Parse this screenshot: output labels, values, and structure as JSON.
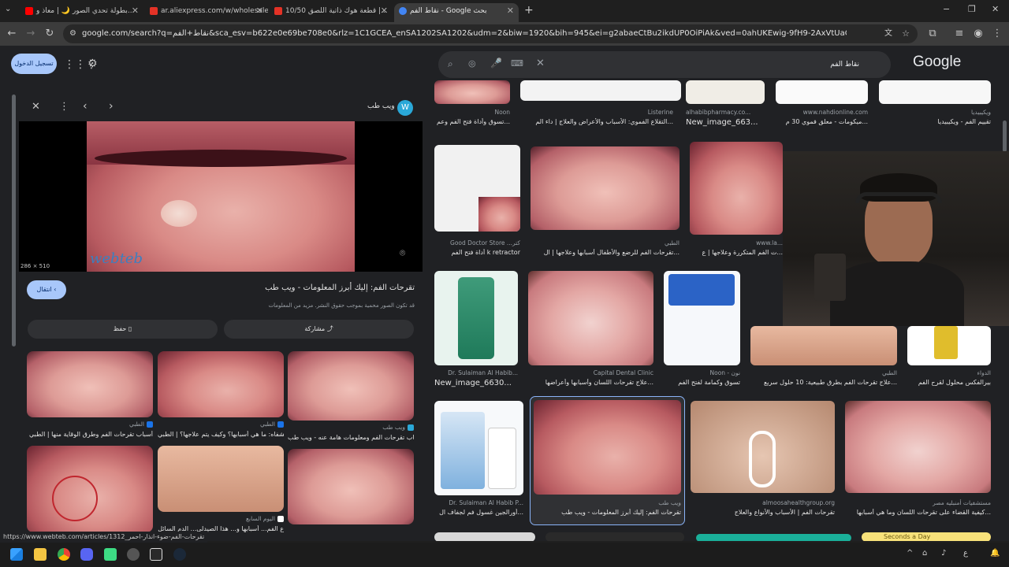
{
  "tabs": [
    {
      "label": "بطولة تحدي الصور 🌙 | معاذ و...",
      "favicon_color": "#ff0000"
    },
    {
      "label": "ar.aliexpress.com/w/wholesale-",
      "favicon_color": "#e43226"
    },
    {
      "label": "10/50 قطعة هوك ذاتية اللصق |...",
      "favicon_color": "#e43226"
    },
    {
      "label": "نقاط الفم - Google بحث",
      "favicon_color": "#4285f4",
      "active": true
    }
  ],
  "toolbar": {
    "url": "google.com/search?q=نقاط+الفم&sca_esv=b622e0e69be708e0&rlz=1C1GCEA_enSA1202SA1202&udm=2&biw=1920&bih=945&ei=g2abaeCtBu2ikdUP0OiPiAk&ved=0ahUKEwig-9fH9-2AxVtUaQEHVD0A5EQ4dUDCBQ&uact=5&oq=نقاط+ال..."
  },
  "header": {
    "signin_label": "تسجيل الدخول",
    "search_query": "نقاط الفم",
    "logo": "Google"
  },
  "panel": {
    "site_name": "ويب طب",
    "image_size": "286 × 510",
    "watermark": "webteb",
    "title": "تقرحات الفم: إليك أبرز المعلومات - ويب طب",
    "visit_label": "انتقال",
    "copyright_note": "قد تكون الصور محمية بموجب حقوق النشر. مزيد من المعلومات",
    "share_label": "مشاركة",
    "save_label": "حفظ",
    "related": [
      {
        "caption": "أسباب تقرحات الفم وطرق الوقاية منها | الطبي",
        "source": "الطبي",
        "badge": "#1a73e8"
      },
      {
        "caption": "تقرحات الشفاه: ما هي أسبابها؟ وكيف يتم علاجها؟ | الطبي",
        "source": "الطبي",
        "badge": "#1a73e8"
      },
      {
        "caption": "أسباب تقرحات الفم ومعلومات هامة عنه - ويب طب",
        "source": "ويب طب",
        "badge": "#2aa8d8"
      },
      {
        "caption": "",
        "source": "",
        "badge": ""
      },
      {
        "caption": "ع الفم... أسبابها و... هذا الصيدلي... الدم السائل",
        "source": "اليوم السابع",
        "badge": "#ffffff"
      },
      {
        "caption": "",
        "source": "",
        "badge": ""
      }
    ]
  },
  "results": {
    "row0": [
      {
        "source": "ويكيبيديا",
        "caption": "تقييم الفم - ويكيبيديا"
      },
      {
        "source": "www.nahdionline.com",
        "caption": "ميكومات - معلق فموي 30 م..."
      },
      {
        "source": "alhabibpharmacy.co...",
        "caption": "New_image_663..."
      },
      {
        "source": "Listerine",
        "caption": "التقلاع الفموي: الأسباب والأعراض والعلاج | داء الم..."
      },
      {
        "source": "Noon",
        "caption": "تسوق وأداة فتح الفم وعم..."
      }
    ],
    "row1": [
      {
        "source": "Good Doctor Store ...كتر",
        "caption": "أداة فتح الفم k retractor"
      },
      {
        "source": "الطبي",
        "caption": "تقرحات الفم للرضع والأطفال أسبابها وعلاجها | ال..."
      },
      {
        "source": "www.la...",
        "caption": "ت الفم المتكررة وعلاجها | ع..."
      }
    ],
    "row2": [
      {
        "source": "Dr. Sulaiman Al Habib...",
        "caption": "New_image_6630..."
      },
      {
        "source": "Capital Dental Clinic",
        "caption": "علاج تقرحات اللسان وأسبابها وأعراضها..."
      },
      {
        "source": "Noon - نون",
        "caption": "تسوق وكمامة لفتح الفم"
      },
      {
        "source": "الطبي",
        "caption": "علاج تقرحات الفم بطرق طبيعية: 10 حلول سريع..."
      },
      {
        "source": "الدواء",
        "caption": "بيرالفكس محلول لقرح الفم"
      }
    ],
    "row3": [
      {
        "source": "Dr. Sulaiman Al Habib P...",
        "caption": "أورالجين غسول فم لجفاف ال..."
      },
      {
        "source": "ويب طب",
        "caption": "تقرحات الفم: إليك أبرز المعلومات - ويب طب"
      },
      {
        "source": "almoosahealthgroup.org",
        "caption": "تقرحات الفم | الأسباب والأنواع والعلاج"
      },
      {
        "source": "مستشفيات أمنبليه مصر",
        "caption": "كيفية القضاء على تقرحات اللسان وما هي أسبابها..."
      }
    ],
    "bottom_partial": "Seconds a Day"
  },
  "statusbar": {
    "url": "https://www.webteb.com/articles/1312_تقرحات-الفم-ضوء-انذار-احمر"
  },
  "taskbar": {
    "tray_lang": "ع",
    "tray_chevron": "^"
  },
  "colors": {
    "background": "#202124",
    "accent": "#a8c7fa",
    "tab_active": "#3c3c3c"
  }
}
